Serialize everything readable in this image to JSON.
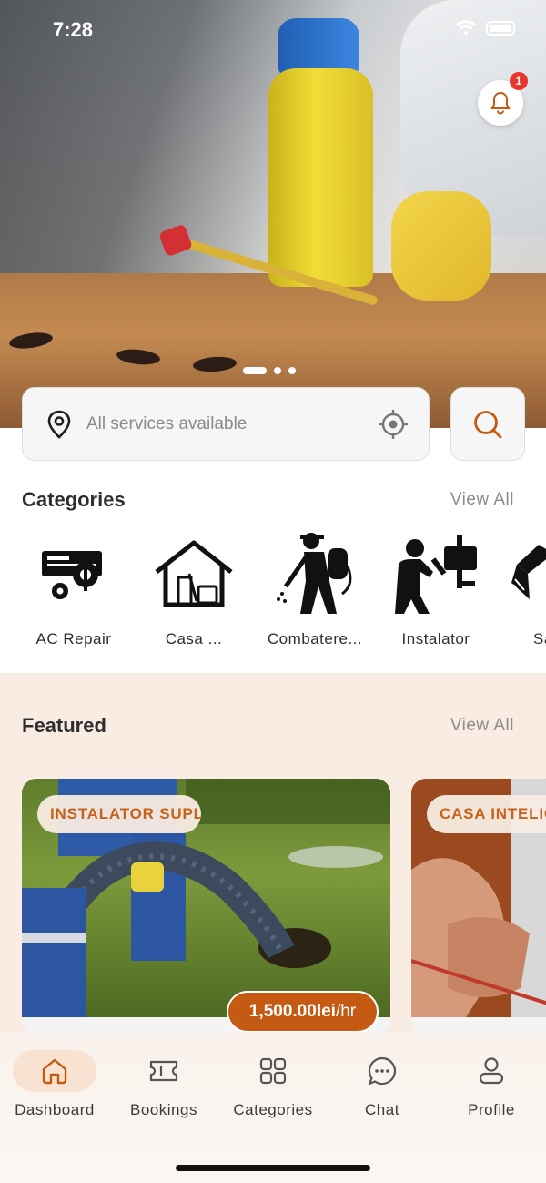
{
  "status_bar": {
    "time": "7:28"
  },
  "hero": {
    "notification_count": "1",
    "carousel_pages": 3,
    "carousel_active": 0
  },
  "search": {
    "placeholder": "All services available"
  },
  "categories": {
    "title": "Categories",
    "view_all": "View All",
    "items": [
      {
        "label": "AC Repair",
        "icon": "ac-repair-icon"
      },
      {
        "label": "Casa ...",
        "icon": "house-cleaning-icon"
      },
      {
        "label": "Combatere...",
        "icon": "pest-control-icon"
      },
      {
        "label": "Instalator",
        "icon": "plumber-icon"
      },
      {
        "label": "Sa",
        "icon": "brush-icon"
      }
    ]
  },
  "featured": {
    "title": "Featured",
    "view_all": "View All",
    "cards": [
      {
        "category": "INSTALATOR SUPLI",
        "price": "1,500.00lei",
        "unit": "/hr"
      },
      {
        "category": "CASA INTELIG"
      }
    ]
  },
  "tabbar": {
    "items": [
      {
        "label": "Dashboard",
        "icon": "home-icon",
        "active": true
      },
      {
        "label": "Bookings",
        "icon": "ticket-icon",
        "active": false
      },
      {
        "label": "Categories",
        "icon": "grid-icon",
        "active": false
      },
      {
        "label": "Chat",
        "icon": "chat-bubble-icon",
        "active": false
      },
      {
        "label": "Profile",
        "icon": "user-icon",
        "active": false
      }
    ]
  },
  "colors": {
    "accent": "#c55a12",
    "accent_light": "#f8e2d2",
    "featured_bg": "#f8ece3"
  }
}
